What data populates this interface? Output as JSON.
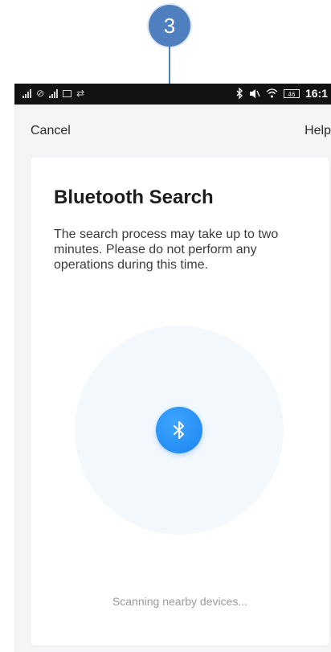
{
  "step": {
    "number": "3"
  },
  "status_bar": {
    "time": "16:1",
    "battery": "46",
    "icons": [
      "signal-icon",
      "no-sim-icon",
      "signal-icon",
      "image-icon",
      "sync-icon",
      "bluetooth-icon",
      "mute-icon",
      "wifi-icon",
      "battery-icon"
    ]
  },
  "nav": {
    "cancel_label": "Cancel",
    "help_label": "Help"
  },
  "card": {
    "title": "Bluetooth Search",
    "description": "The search process may take up to two minutes. Please do not perform any operations during this time.",
    "status": "Scanning nearby devices..."
  },
  "colors": {
    "accent": "#1a84f0",
    "badge": "#4f7fbf",
    "radar": "#f3f8fd",
    "screen_bg": "#f4f5f7"
  }
}
